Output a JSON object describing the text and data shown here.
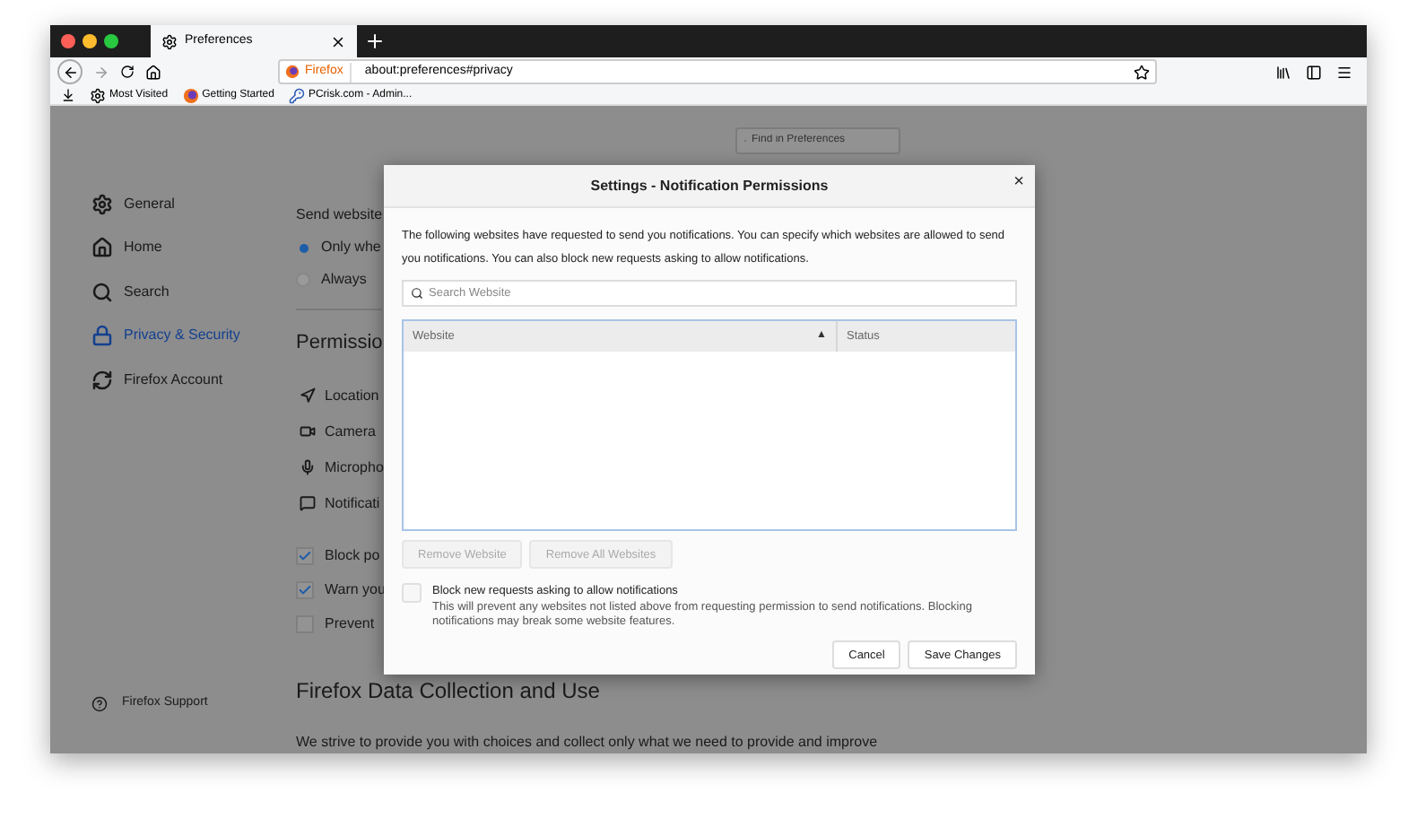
{
  "browser": {
    "tabs": [
      {
        "title": "Preferences",
        "selected": true
      }
    ],
    "identity": "Firefox",
    "url": "about:preferences#privacy",
    "bookmarks": [
      {
        "label": "Most Visited"
      },
      {
        "label": "Getting Started"
      },
      {
        "label": "PCrisk.com - Admin..."
      }
    ]
  },
  "search": {
    "placeholder": "Find in Preferences"
  },
  "sidebar": {
    "items": [
      {
        "label": "General",
        "selected": false
      },
      {
        "label": "Home",
        "selected": false
      },
      {
        "label": "Search",
        "selected": false
      },
      {
        "label": "Privacy & Security",
        "selected": true
      },
      {
        "label": "Firefox Account",
        "selected": false
      }
    ],
    "support": "Firefox Support"
  },
  "content": {
    "notifications_heading": "Send website",
    "radio_options": [
      {
        "label": "Only whe",
        "selected": true
      },
      {
        "label": "Always",
        "selected": false
      }
    ],
    "permissions_heading": "Permissio",
    "permissions": [
      {
        "label": "Location"
      },
      {
        "label": "Camera"
      },
      {
        "label": "Micropho"
      },
      {
        "label": "Notificati"
      }
    ],
    "checkboxes": [
      {
        "label": "Block po",
        "checked": true
      },
      {
        "label": "Warn you",
        "checked": true
      },
      {
        "label": "Prevent",
        "checked": false
      }
    ],
    "data_heading": "Firefox Data Collection and Use",
    "data_text": "We strive to provide you with choices and collect only what we need to provide and improve"
  },
  "dialog": {
    "title": "Settings - Notification Permissions",
    "close": "×",
    "description": "The following websites have requested to send you notifications. You can specify which websites are allowed to send you notifications. You can also block new requests asking to allow notifications.",
    "search": {
      "placeholder": "Search Website"
    },
    "table": {
      "columns": [
        {
          "label": "Website",
          "sort": "▲"
        },
        {
          "label": "Status"
        }
      ]
    },
    "remove_buttons": [
      {
        "label": "Remove Website",
        "disabled": true
      },
      {
        "label": "Remove All Websites",
        "disabled": true
      }
    ],
    "block": {
      "label": "Block new requests asking to allow notifications",
      "checked": false,
      "note": "This will prevent any websites not listed above from requesting permission to send notifications. Blocking notifications may break some website features."
    },
    "buttons": [
      "Cancel",
      "Save Changes"
    ]
  }
}
